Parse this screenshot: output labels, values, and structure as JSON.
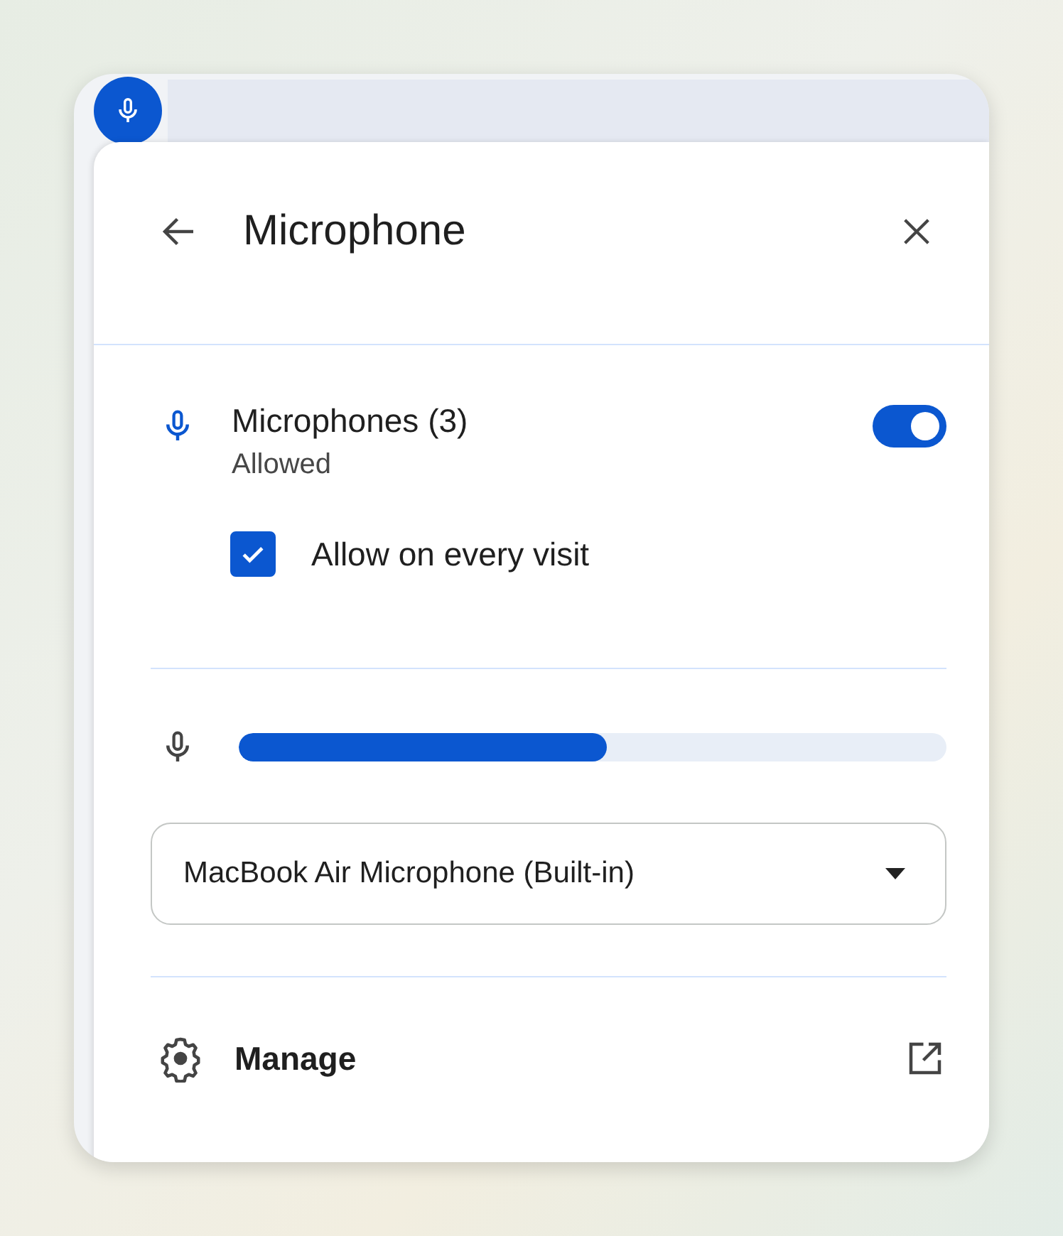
{
  "panel": {
    "title": "Microphone"
  },
  "permission": {
    "label": "Microphones (3)",
    "status": "Allowed",
    "on": true,
    "remember": {
      "label": "Allow on every visit",
      "checked": true
    }
  },
  "input_level": {
    "level": 0.52
  },
  "device_select": {
    "value": "MacBook Air Microphone (Built-in)"
  },
  "manage": {
    "label": "Manage"
  }
}
